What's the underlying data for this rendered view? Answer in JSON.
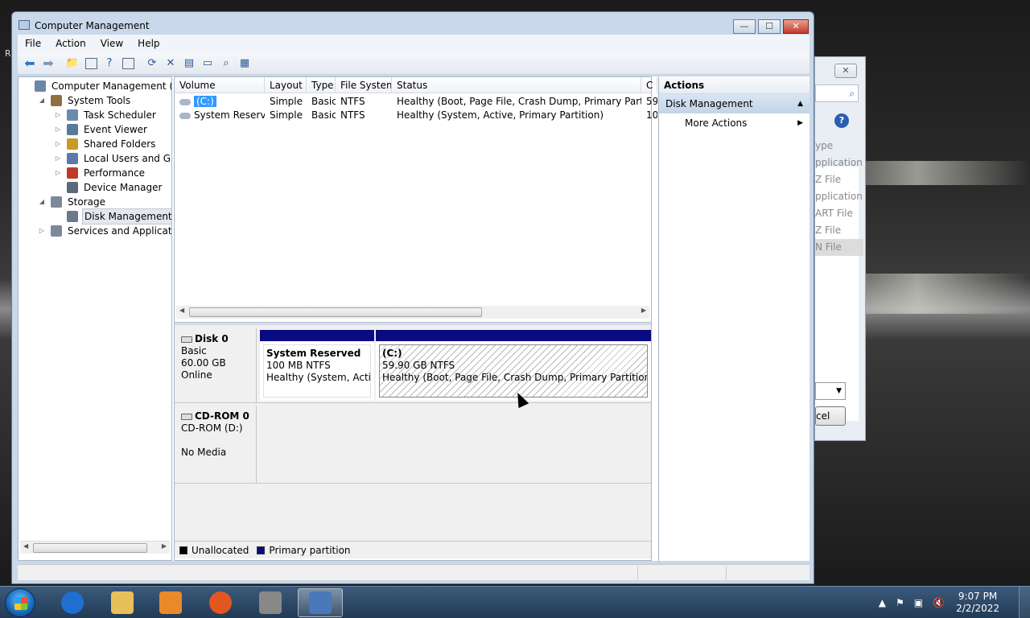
{
  "desktop": {
    "edge_letter": "R"
  },
  "bg_window": {
    "close_label": "✕",
    "items": [
      "ype",
      "pplication",
      "Z File",
      "pplication",
      "ART File",
      "Z File",
      "N File"
    ],
    "cancel_label": "cel"
  },
  "window": {
    "title": "Computer Management",
    "caption": {
      "minimize": "—",
      "maximize": "☐",
      "close": "✕"
    }
  },
  "menu": [
    "File",
    "Action",
    "View",
    "Help"
  ],
  "toolbar_icons": [
    "back-icon",
    "forward-icon",
    "up-folder-icon",
    "show-hide-tree-icon",
    "help-icon",
    "show-hide-action-icon",
    "refresh-icon",
    "delete-icon",
    "properties-icon",
    "open-icon",
    "search-icon",
    "settings-icon"
  ],
  "tree": [
    {
      "label": "Computer Management (Local",
      "level": 0,
      "expander": "",
      "icon": "computer-icon",
      "selected": false
    },
    {
      "label": "System Tools",
      "level": 1,
      "expander": "◢",
      "icon": "tools-icon",
      "selected": false
    },
    {
      "label": "Task Scheduler",
      "level": 2,
      "expander": "▷",
      "icon": "clock-icon",
      "selected": false
    },
    {
      "label": "Event Viewer",
      "level": 2,
      "expander": "▷",
      "icon": "event-viewer-icon",
      "selected": false
    },
    {
      "label": "Shared Folders",
      "level": 2,
      "expander": "▷",
      "icon": "shared-folder-icon",
      "selected": false
    },
    {
      "label": "Local Users and Groups",
      "level": 2,
      "expander": "▷",
      "icon": "users-icon",
      "selected": false
    },
    {
      "label": "Performance",
      "level": 2,
      "expander": "▷",
      "icon": "performance-icon",
      "selected": false
    },
    {
      "label": "Device Manager",
      "level": 2,
      "expander": "",
      "icon": "device-manager-icon",
      "selected": false
    },
    {
      "label": "Storage",
      "level": 1,
      "expander": "◢",
      "icon": "storage-icon",
      "selected": false
    },
    {
      "label": "Disk Management",
      "level": 2,
      "expander": "",
      "icon": "disk-icon",
      "selected": true
    },
    {
      "label": "Services and Applications",
      "level": 1,
      "expander": "▷",
      "icon": "services-icon",
      "selected": false
    }
  ],
  "volumes": {
    "columns": [
      "Volume",
      "Layout",
      "Type",
      "File System",
      "Status",
      "C"
    ],
    "rows": [
      {
        "volume": "(C:)",
        "layout": "Simple",
        "type": "Basic",
        "fs": "NTFS",
        "status": "Healthy (Boot, Page File, Crash Dump, Primary Partition)",
        "cap": "59",
        "selected": true
      },
      {
        "volume": "System Reserved",
        "layout": "Simple",
        "type": "Basic",
        "fs": "NTFS",
        "status": "Healthy (System, Active, Primary Partition)",
        "cap": "10",
        "selected": false
      }
    ]
  },
  "disks": [
    {
      "name": "Disk 0",
      "lines": [
        "Basic",
        "60.00 GB",
        "Online"
      ],
      "partitions": [
        {
          "title": "System Reserved",
          "size": "100 MB NTFS",
          "status": "Healthy (System, Active,",
          "hatched": false
        },
        {
          "title": "(C:)",
          "size": "59.90 GB NTFS",
          "status": "Healthy (Boot, Page File, Crash Dump, Primary Partition)",
          "hatched": true
        }
      ]
    },
    {
      "name": "CD-ROM 0",
      "lines": [
        "CD-ROM (D:)",
        "",
        "No Media"
      ],
      "partitions": []
    }
  ],
  "legend": [
    {
      "label": "Unallocated",
      "color": "#000000"
    },
    {
      "label": "Primary partition",
      "color": "#0a0a82"
    }
  ],
  "actions": {
    "header": "Actions",
    "section": "Disk Management",
    "items": [
      "More Actions"
    ]
  },
  "taskbar": {
    "apps": [
      "internet-explorer-icon",
      "file-explorer-icon",
      "media-player-icon",
      "firefox-icon",
      "usb-drive-icon",
      "computer-management-icon"
    ],
    "active_index": 5,
    "clock_time": "9:07 PM",
    "clock_date": "2/2/2022"
  }
}
